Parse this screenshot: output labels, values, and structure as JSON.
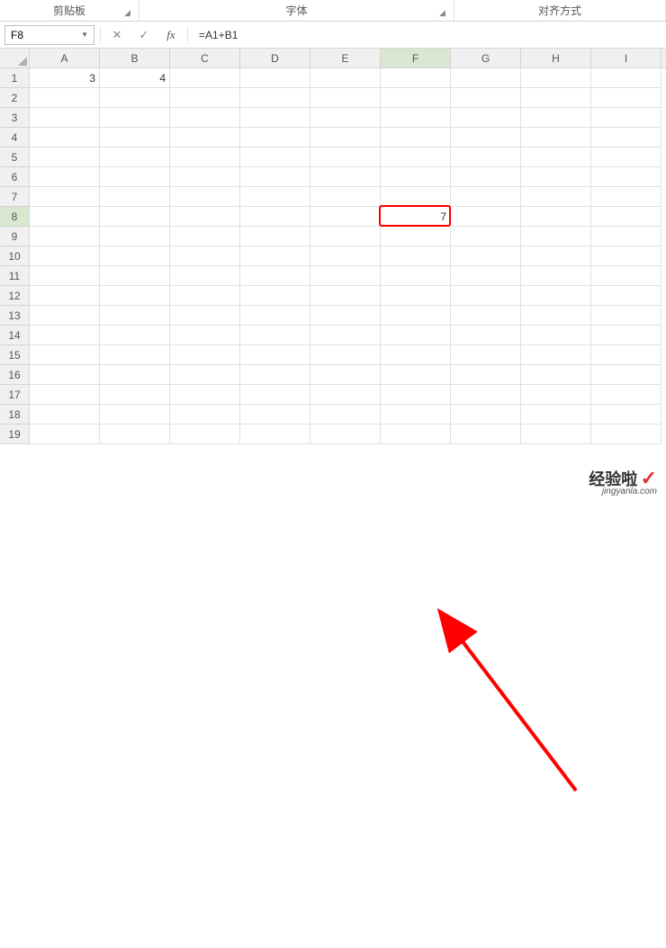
{
  "ribbon": {
    "clipboard": "剪贴板",
    "font": "字体",
    "alignment": "对齐方式"
  },
  "formula_bar": {
    "name_box": "F8",
    "formula": "=A1+B1",
    "fx_label": "fx"
  },
  "columns": [
    "A",
    "B",
    "C",
    "D",
    "E",
    "F",
    "G",
    "H",
    "I"
  ],
  "rows": [
    "1",
    "2",
    "3",
    "4",
    "5",
    "6",
    "7",
    "8",
    "9",
    "10",
    "11",
    "12",
    "13",
    "14",
    "15",
    "16",
    "17",
    "18",
    "19"
  ],
  "active_col_index": 5,
  "active_row_index": 7,
  "cells": {
    "A1": "3",
    "B1": "4",
    "F8": "7"
  },
  "watermark": {
    "brand": "经验啦",
    "url": "jingyanla.com",
    "check": "✓"
  }
}
